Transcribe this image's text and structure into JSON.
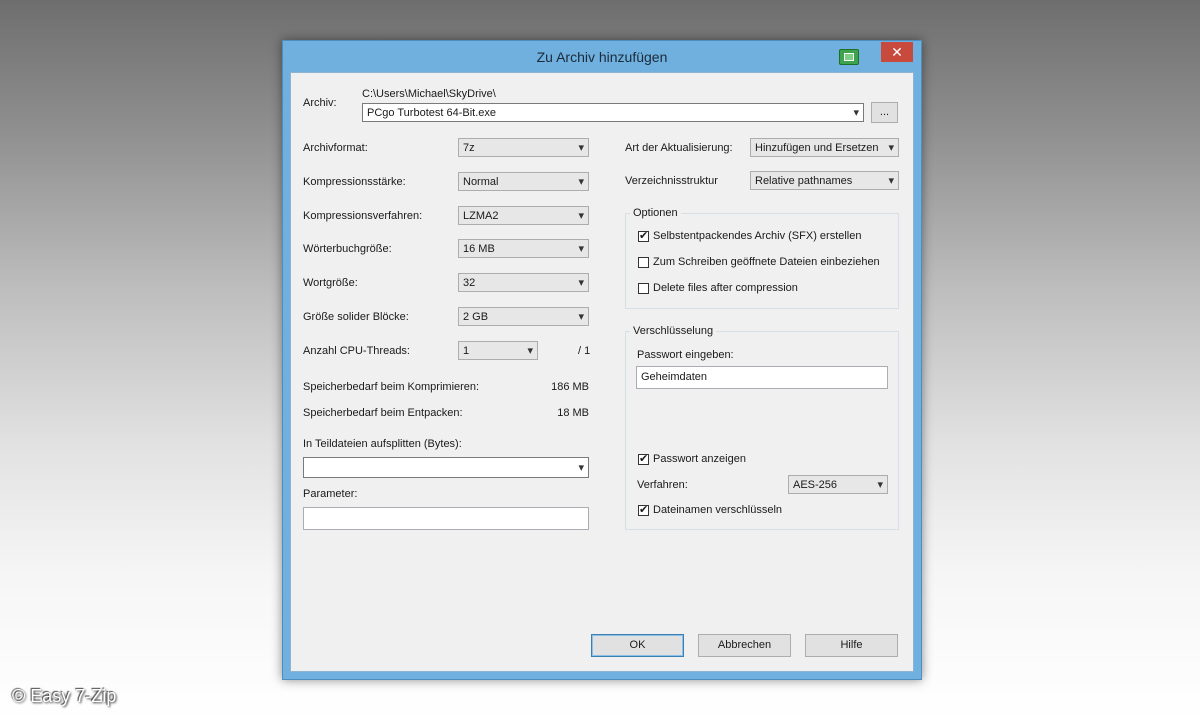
{
  "window": {
    "title": "Zu Archiv hinzufügen",
    "close_glyph": "✕"
  },
  "archive": {
    "label": "Archiv:",
    "path": "C:\\Users\\Michael\\SkyDrive\\",
    "filename": "PCgo Turbotest 64-Bit.exe",
    "browse_label": "..."
  },
  "left": {
    "format": {
      "label": "Archivformat:",
      "value": "7z"
    },
    "level": {
      "label": "Kompressionsstärke:",
      "value": "Normal"
    },
    "method": {
      "label": "Kompressionsverfahren:",
      "value": "LZMA2"
    },
    "dict": {
      "label": "Wörterbuchgröße:",
      "value": "16 MB"
    },
    "word": {
      "label": "Wortgröße:",
      "value": "32"
    },
    "solid": {
      "label": "Größe solider Blöcke:",
      "value": "2 GB"
    },
    "threads": {
      "label": "Anzahl CPU-Threads:",
      "value": "1",
      "max": "/ 1"
    },
    "mem_compress": {
      "label": "Speicherbedarf beim Komprimieren:",
      "value": "186 MB"
    },
    "mem_decompress": {
      "label": "Speicherbedarf beim Entpacken:",
      "value": "18 MB"
    },
    "split": {
      "label": "In Teildateien aufsplitten (Bytes):",
      "value": ""
    },
    "params": {
      "label": "Parameter:",
      "value": ""
    }
  },
  "right": {
    "update_mode": {
      "label": "Art der Aktualisierung:",
      "value": "Hinzufügen und Ersetzen"
    },
    "path_mode": {
      "label": "Verzeichnisstruktur",
      "value": "Relative pathnames"
    },
    "options": {
      "title": "Optionen",
      "sfx": {
        "label": "Selbstentpackendes Archiv (SFX) erstellen",
        "checked": true
      },
      "shared": {
        "label": "Zum Schreiben geöffnete Dateien einbeziehen",
        "checked": false
      },
      "delete": {
        "label": "Delete files after compression",
        "checked": false
      }
    },
    "encryption": {
      "title": "Verschlüsselung",
      "password_label": "Passwort eingeben:",
      "password_value": "Geheimdaten",
      "show_password": {
        "label": "Passwort anzeigen",
        "checked": true
      },
      "method_label": "Verfahren:",
      "method_value": "AES-256",
      "encrypt_names": {
        "label": "Dateinamen verschlüsseln",
        "checked": true
      }
    }
  },
  "buttons": {
    "ok": "OK",
    "cancel": "Abbrechen",
    "help": "Hilfe"
  },
  "watermark": "© Easy 7-Zip",
  "icons": {
    "dropdown": "chevron-down-icon",
    "check": "✔"
  }
}
